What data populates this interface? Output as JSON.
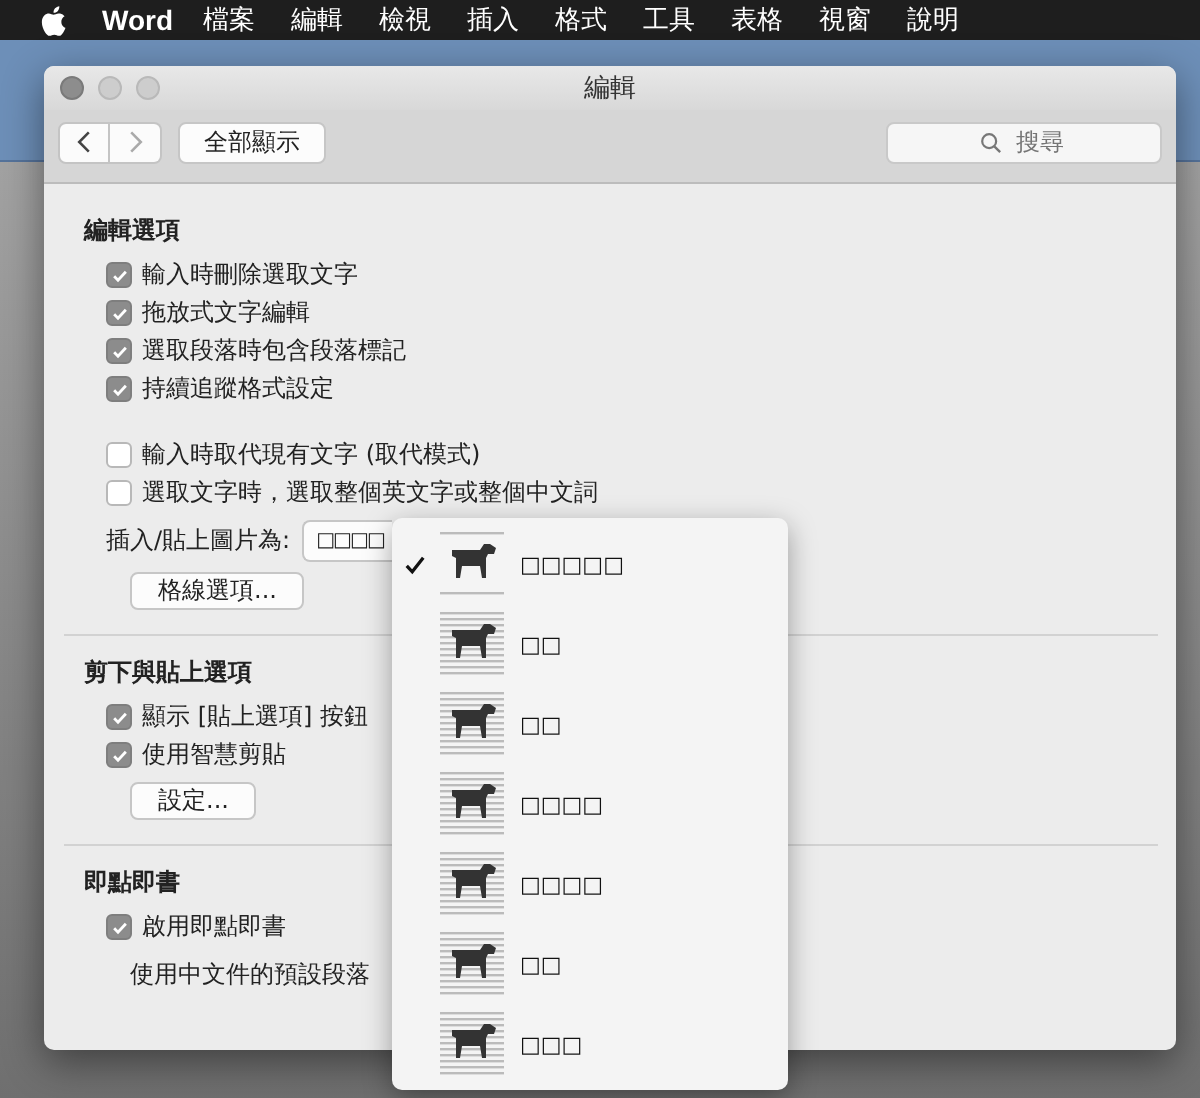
{
  "menu_bar": {
    "app_name": "Word",
    "menus": [
      "檔案",
      "編輯",
      "檢視",
      "插入",
      "格式",
      "工具",
      "表格",
      "視窗",
      "說明"
    ]
  },
  "dialog": {
    "title": "編輯",
    "show_all": "全部顯示",
    "search": {
      "placeholder": "搜尋"
    },
    "sections": [
      {
        "title": "編輯選項",
        "groups": [
          [
            {
              "kind": "checkbox",
              "label": "輸入時刪除選取文字",
              "checked": true
            },
            {
              "kind": "checkbox",
              "label": "拖放式文字編輯",
              "checked": true
            },
            {
              "kind": "checkbox",
              "label": "選取段落時包含段落標記",
              "checked": true
            },
            {
              "kind": "checkbox",
              "label": "持續追蹤格式設定",
              "checked": true
            }
          ],
          [
            {
              "kind": "checkbox",
              "label": "輸入時取代現有文字 (取代模式)",
              "checked": false
            },
            {
              "kind": "checkbox",
              "label": "選取文字時，選取整個英文字或整個中文詞",
              "checked": false
            },
            {
              "kind": "popup",
              "label": "插入/貼上圖片為:",
              "value": "□□□□"
            },
            {
              "kind": "button",
              "label": "格線選項..."
            }
          ]
        ]
      },
      {
        "title": "剪下與貼上選項",
        "groups": [
          [
            {
              "kind": "checkbox",
              "label": "顯示 [貼上選項] 按鈕",
              "checked": true
            },
            {
              "kind": "checkbox",
              "label": "使用智慧剪貼",
              "checked": true
            },
            {
              "kind": "button",
              "label": "設定..."
            }
          ]
        ]
      },
      {
        "title": "即點即書",
        "groups": [
          [
            {
              "kind": "checkbox",
              "label": "啟用即點即書",
              "checked": true
            },
            {
              "kind": "text",
              "label": "使用中文件的預設段落"
            }
          ]
        ]
      }
    ]
  },
  "popup_menu": {
    "items": [
      {
        "label": "□□□□□",
        "selected": true
      },
      {
        "label": "□□",
        "selected": false
      },
      {
        "label": "□□",
        "selected": false
      },
      {
        "label": "□□□□",
        "selected": false
      },
      {
        "label": "□□□□",
        "selected": false
      },
      {
        "label": "□□",
        "selected": false
      },
      {
        "label": "□□□",
        "selected": false
      }
    ]
  }
}
